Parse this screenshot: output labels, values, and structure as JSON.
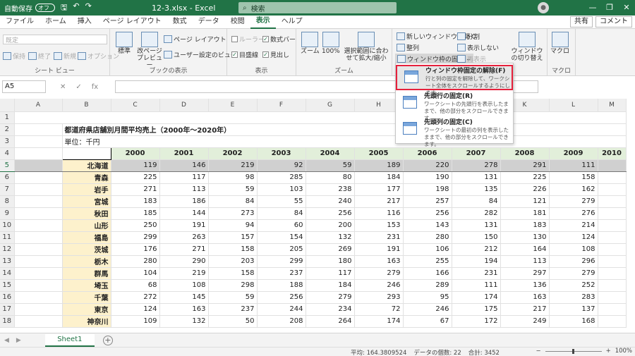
{
  "titlebar": {
    "autosave_label": "自動保存",
    "autosave_state": "オフ",
    "document": "12-3.xlsx  -  Excel",
    "search_placeholder": "検索",
    "minimize": "—",
    "restore": "❐",
    "close": "✕"
  },
  "tabs": [
    "ファイル",
    "ホーム",
    "挿入",
    "ページ レイアウト",
    "数式",
    "データ",
    "校閲",
    "表示",
    "ヘルプ"
  ],
  "active_tab": "表示",
  "share": "共有",
  "comment": "コメント",
  "ribbon": {
    "sheetview": {
      "label": "シート ビュー",
      "dropdown": "既定",
      "keep": "保持",
      "exit": "終了",
      "new": "新規",
      "options": "オプション"
    },
    "bookview": {
      "label": "ブックの表示",
      "normal": "標準",
      "pagebreak": "改ページ プレビュー",
      "pagelayout": "ページ レイアウト",
      "custom": "ユーザー設定のビュー"
    },
    "show": {
      "label": "表示",
      "ruler": "ルーラー",
      "formulabar": "数式バー",
      "gridlines": "目盛線",
      "headings": "見出し"
    },
    "zoom": {
      "label": "ズーム",
      "zoom": "ズーム",
      "hundred": "100%",
      "selection": "選択範囲に合わせて拡大/縮小"
    },
    "window": {
      "newwindow": "新しいウィンドウを開く",
      "arrange": "整列",
      "freeze": "ウィンドウ枠の固定",
      "split": "分割",
      "hide": "表示しない",
      "unhide": "再表示",
      "switch": "ウィンドウの切り替え"
    },
    "macro": {
      "label": "マクロ",
      "macro": "マクロ"
    }
  },
  "formula": {
    "namebox": "A5",
    "fx": "fx",
    "cancel": "✕",
    "enter": "✓"
  },
  "freeze_menu": [
    {
      "title": "ウィンドウ枠固定の解除(F)",
      "desc": "行と列の固定を解除して、ワークシート全体をスクロールするようにします。"
    },
    {
      "title": "先頭行の固定(R)",
      "desc": "ワークシートの先頭行を表示したままで、他の部分をスクロールできます。"
    },
    {
      "title": "先頭列の固定(C)",
      "desc": "ワークシートの最初の列を表示したままで、他の部分をスクロールできます。"
    }
  ],
  "sheet": {
    "columns": [
      "A",
      "B",
      "C",
      "D",
      "E",
      "F",
      "G",
      "H",
      "I",
      "J",
      "K",
      "L",
      "M"
    ],
    "title": "都道府県店舗別月間平均売上（2000年～2020年）",
    "unit": "単位：千円",
    "years": [
      "2000",
      "2001",
      "2002",
      "2003",
      "2004",
      "2005",
      "2006",
      "2007",
      "2008",
      "2009",
      "2010"
    ],
    "rows": [
      {
        "n": "5",
        "pref": "北海道",
        "v": [
          "119",
          "146",
          "219",
          "92",
          "59",
          "189",
          "220",
          "278",
          "291",
          "111",
          ""
        ]
      },
      {
        "n": "6",
        "pref": "青森",
        "v": [
          "225",
          "117",
          "98",
          "285",
          "80",
          "184",
          "190",
          "131",
          "225",
          "158",
          ""
        ]
      },
      {
        "n": "7",
        "pref": "岩手",
        "v": [
          "271",
          "113",
          "59",
          "103",
          "238",
          "177",
          "198",
          "135",
          "226",
          "162",
          ""
        ]
      },
      {
        "n": "8",
        "pref": "宮城",
        "v": [
          "183",
          "186",
          "84",
          "55",
          "240",
          "217",
          "257",
          "84",
          "121",
          "279",
          ""
        ]
      },
      {
        "n": "9",
        "pref": "秋田",
        "v": [
          "185",
          "144",
          "273",
          "84",
          "256",
          "116",
          "256",
          "282",
          "181",
          "276",
          ""
        ]
      },
      {
        "n": "10",
        "pref": "山形",
        "v": [
          "250",
          "191",
          "94",
          "60",
          "200",
          "153",
          "143",
          "131",
          "183",
          "214",
          ""
        ]
      },
      {
        "n": "11",
        "pref": "福島",
        "v": [
          "299",
          "263",
          "157",
          "154",
          "132",
          "231",
          "280",
          "150",
          "130",
          "124",
          ""
        ]
      },
      {
        "n": "12",
        "pref": "茨城",
        "v": [
          "176",
          "271",
          "158",
          "205",
          "269",
          "191",
          "106",
          "212",
          "164",
          "108",
          ""
        ]
      },
      {
        "n": "13",
        "pref": "栃木",
        "v": [
          "280",
          "290",
          "203",
          "299",
          "180",
          "163",
          "255",
          "194",
          "113",
          "296",
          ""
        ]
      },
      {
        "n": "14",
        "pref": "群馬",
        "v": [
          "104",
          "219",
          "158",
          "237",
          "117",
          "279",
          "166",
          "231",
          "297",
          "279",
          ""
        ]
      },
      {
        "n": "15",
        "pref": "埼玉",
        "v": [
          "68",
          "108",
          "298",
          "188",
          "184",
          "246",
          "289",
          "111",
          "136",
          "252",
          ""
        ]
      },
      {
        "n": "16",
        "pref": "千葉",
        "v": [
          "272",
          "145",
          "59",
          "256",
          "279",
          "293",
          "95",
          "174",
          "163",
          "283",
          ""
        ]
      },
      {
        "n": "17",
        "pref": "東京",
        "v": [
          "124",
          "163",
          "237",
          "244",
          "234",
          "72",
          "246",
          "175",
          "217",
          "137",
          ""
        ]
      },
      {
        "n": "18",
        "pref": "神奈川",
        "v": [
          "109",
          "132",
          "50",
          "208",
          "264",
          "174",
          "67",
          "172",
          "249",
          "168",
          ""
        ]
      }
    ]
  },
  "sheet_tab": "Sheet1",
  "status": {
    "average": "平均: 164.3809524",
    "count": "データの個数: 22",
    "sum": "合計: 3452",
    "zoom": "100%"
  }
}
